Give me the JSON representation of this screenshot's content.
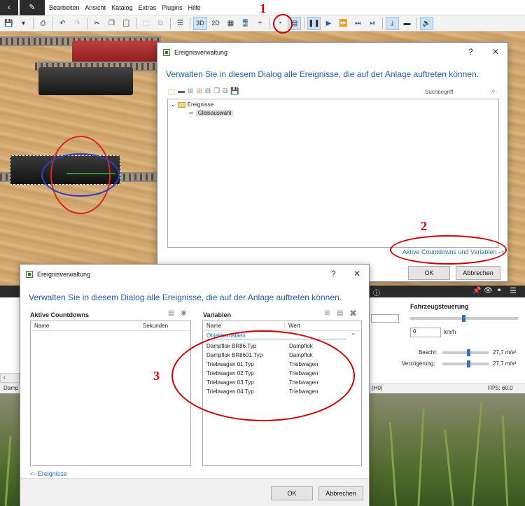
{
  "menu": {
    "items": [
      "Bearbeiten",
      "Ansicht",
      "Katalog",
      "Extras",
      "Plugins",
      "Hilfe"
    ]
  },
  "toolbar": {
    "btn_3d": "3D",
    "btn_2d": "2D"
  },
  "annotations": {
    "one": "1",
    "two": "2",
    "three": "3",
    "color": "#cc0000"
  },
  "dialog1": {
    "title": "Ereignisverwaltung",
    "help": "?",
    "close": "✕",
    "headline": "Verwalten Sie in diesem Dialog alle Ereignisse, die auf der Anlage auftreten können.",
    "search_placeholder": "Suchbegriff",
    "tree_root": "Ereignisse",
    "tree_child": "Gleisauswahl",
    "link": "Aktive Countdowns und Variablen ->",
    "ok": "OK",
    "cancel": "Abbrechen"
  },
  "dialog2": {
    "title": "Ereignisverwaltung",
    "help": "?",
    "close": "✕",
    "headline": "Verwalten Sie in diesem Dialog alle Ereignisse, die auf der Anlage auftreten können.",
    "countdowns_title": "Aktive Countdowns",
    "countdowns_col_name": "Name",
    "countdowns_col_seconds": "Sekunden",
    "variables_title": "Variablen",
    "variables_col_name": "Name",
    "variables_col_value": "Wert",
    "group": "Objektvariablen",
    "variables": [
      {
        "name": "Dampflok BR86.Typ",
        "value": "Dampflok"
      },
      {
        "name": "Dampflok BR8601.Typ",
        "value": "Dampflok"
      },
      {
        "name": "Triebwagen 01.Typ",
        "value": "Triebwagen"
      },
      {
        "name": "Triebwagen 02.Typ",
        "value": "Triebwagen"
      },
      {
        "name": "Triebwagen 03.Typ",
        "value": "Triebwagen"
      },
      {
        "name": "Triebwagen 04.Typ",
        "value": "Triebwagen"
      }
    ],
    "back_link": "<- Ereignisse",
    "ok": "OK",
    "cancel": "Abbrechen"
  },
  "vehicle": {
    "title": "Fahrzeugsteuerung",
    "speed_value": "0",
    "speed_unit": "km/h",
    "accel_label": "Beschl:",
    "accel_value": "27,7 m/s²",
    "decel_label": "Verzögerung:",
    "decel_value": "27,7 m/s²"
  },
  "status": {
    "left": "Damp",
    "mid": "(H0)",
    "fps": "FPS: 60,0"
  }
}
